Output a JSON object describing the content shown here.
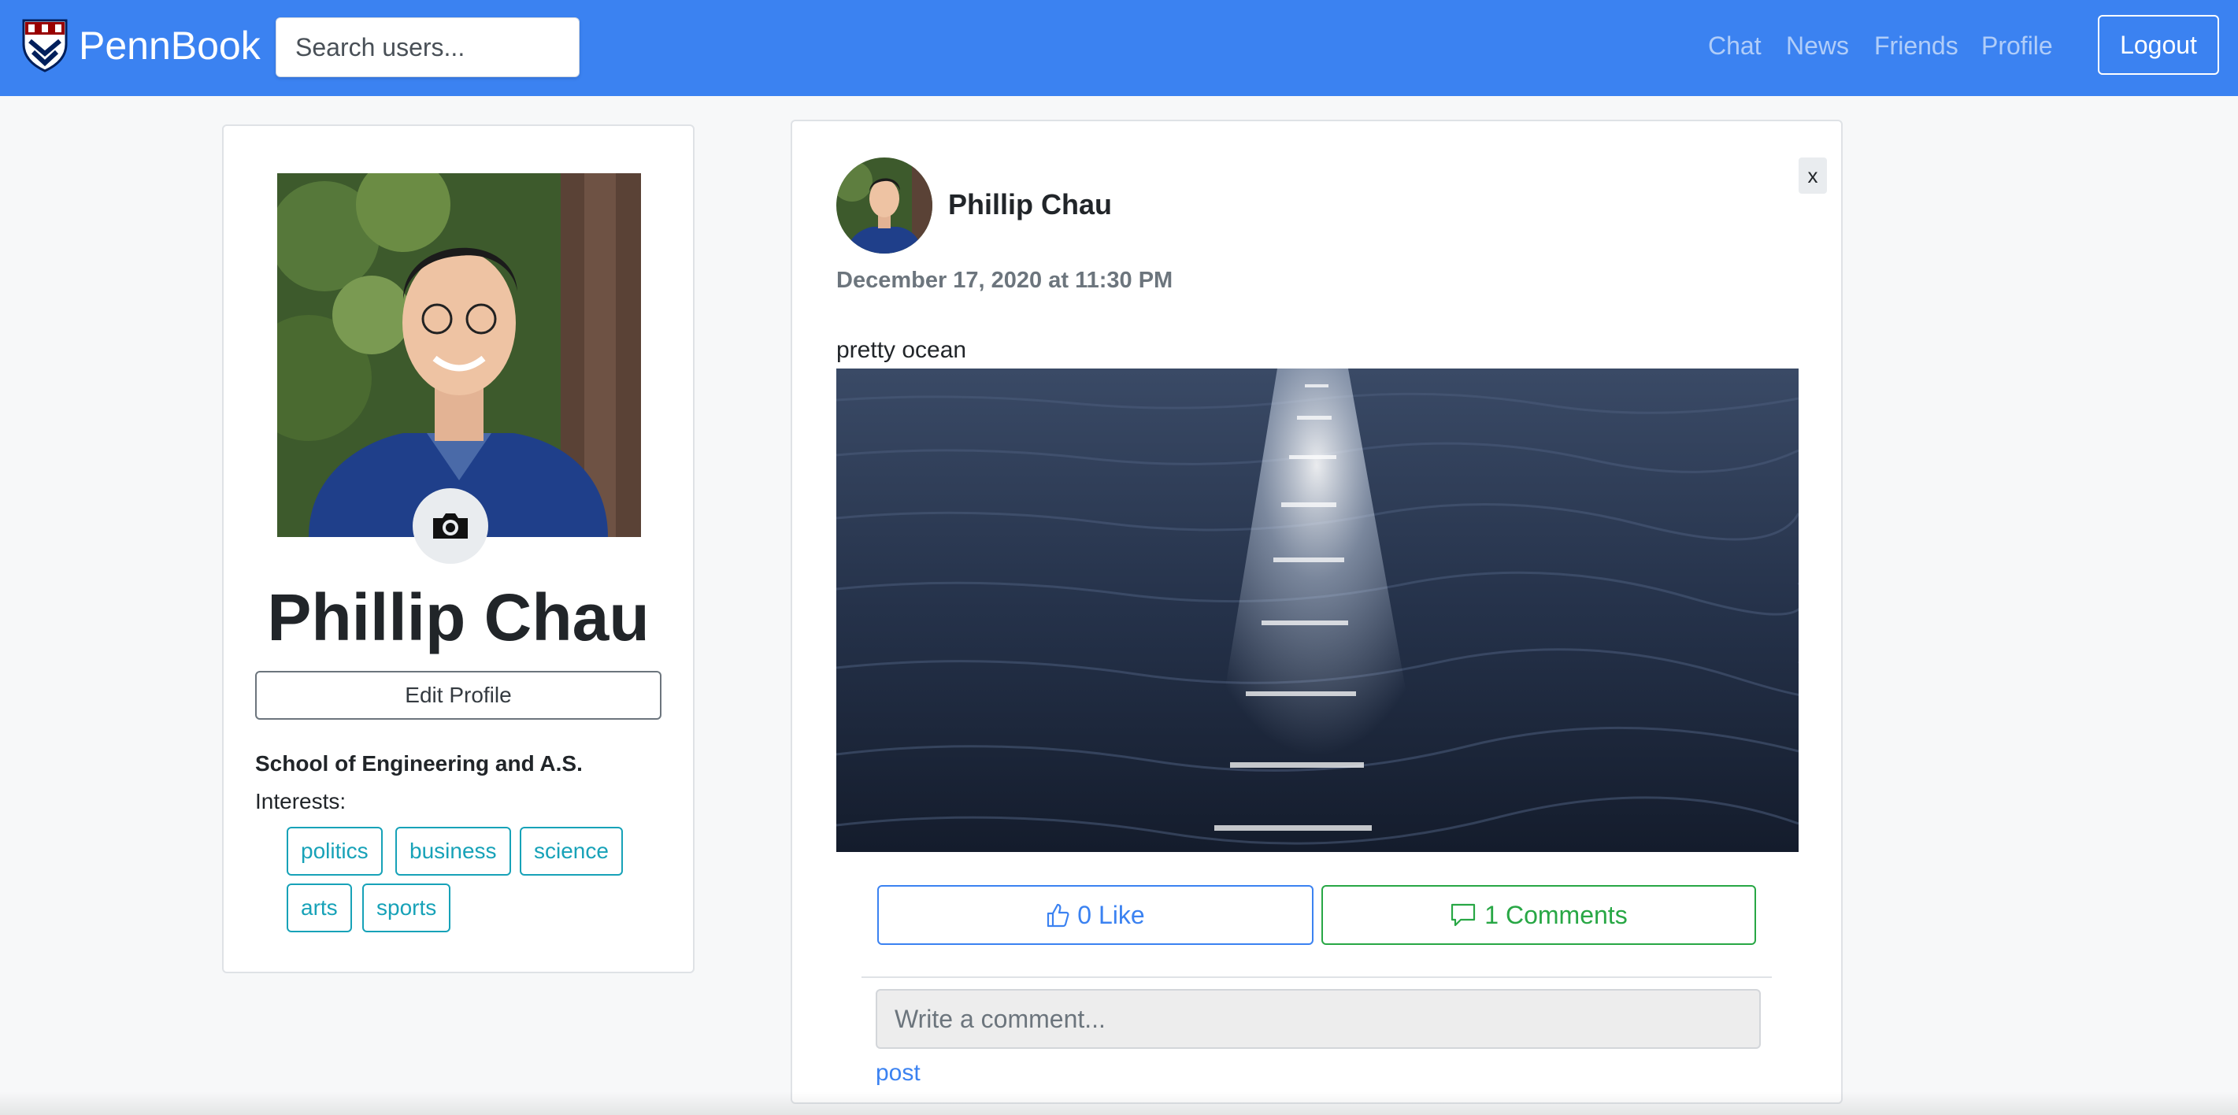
{
  "navbar": {
    "brand": "PennBook",
    "search_placeholder": "Search users...",
    "links": [
      "Chat",
      "News",
      "Friends",
      "Profile"
    ],
    "logout_label": "Logout",
    "background_color": "#3b82f1"
  },
  "profile": {
    "name": "Phillip Chau",
    "edit_label": "Edit Profile",
    "school": "School of Engineering and A.S.",
    "interests_label": "Interests:",
    "interests": [
      "politics",
      "business",
      "science",
      "arts",
      "sports"
    ],
    "camera_icon": "camera-icon"
  },
  "post": {
    "author": "Phillip Chau",
    "date": "December 17, 2020 at 11:30 PM",
    "text": "pretty ocean",
    "close_label": "x",
    "like_label": "0 Like",
    "like_icon": "thumbs-up-icon",
    "comments_label": "1 Comments",
    "comments_icon": "chat-bubble-icon",
    "comment_placeholder": "Write a comment...",
    "post_label": "post"
  },
  "colors": {
    "accent": "#3b82f1",
    "info": "#17a2b8",
    "success": "#28a745"
  }
}
